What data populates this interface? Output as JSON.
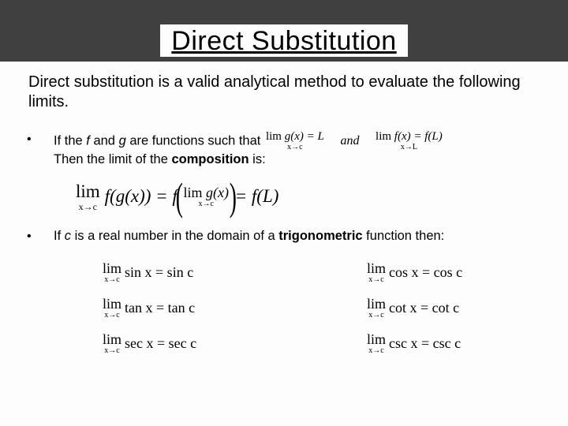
{
  "title": "Direct Substitution",
  "intro": "Direct substitution is a valid analytical method to evaluate the following limits.",
  "bullet1": {
    "prefix": "If the ",
    "f": "f",
    "and1": " and ",
    "g": "g",
    "mid": " are functions such that ",
    "lim1_top": "lim",
    "lim1_bot": "x→c",
    "lim1_expr": "g(x) = L",
    "and_word": "and",
    "lim2_top": "lim",
    "lim2_bot": "x→L",
    "lim2_expr": "f(x) = f(L)",
    "line2a": "Then the limit of the ",
    "line2b": "composition",
    "line2c": " is:"
  },
  "big_eq": {
    "lim_top": "lim",
    "lim_bot": "x→c",
    "fg": "f(g(x)) = f",
    "inner_lim_top": "lim",
    "inner_lim_bot": "x→c",
    "inner_expr": "g(x)",
    "tail": "= f(L)"
  },
  "bullet2": {
    "prefix": "If ",
    "c": "c",
    "mid": " is a real number in the domain of a ",
    "trigword": "trigonometric",
    "suffix": " function then:"
  },
  "trig": {
    "lim_top": "lim",
    "lim_bot": "x→c",
    "items": [
      {
        "lhs": "sin x",
        "rhs": "= sin c"
      },
      {
        "lhs": "cos x",
        "rhs": "= cos c"
      },
      {
        "lhs": "tan x",
        "rhs": "= tan c"
      },
      {
        "lhs": "cot x",
        "rhs": "= cot c"
      },
      {
        "lhs": "sec x",
        "rhs": "= sec c"
      },
      {
        "lhs": "csc x",
        "rhs": "= csc c"
      }
    ]
  }
}
